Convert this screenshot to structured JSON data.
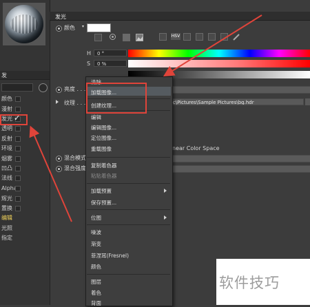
{
  "left_panel": {
    "header": "发",
    "channels": [
      {
        "label": "颜色",
        "checked": false
      },
      {
        "label": "漫射",
        "checked": false
      },
      {
        "label": "发光",
        "checked": true
      },
      {
        "label": "透明",
        "checked": false
      },
      {
        "label": "反射",
        "checked": false
      },
      {
        "label": "环境",
        "checked": false
      },
      {
        "label": "烟雾",
        "checked": false
      },
      {
        "label": "凹凸",
        "checked": false
      },
      {
        "label": "法线",
        "checked": false
      },
      {
        "label": "Alpha",
        "checked": false
      },
      {
        "label": "辉光",
        "checked": false
      },
      {
        "label": "置换",
        "checked": false
      },
      {
        "label": "编辑",
        "checked": false
      },
      {
        "label": "光照",
        "checked": false
      },
      {
        "label": "指定",
        "checked": false
      }
    ],
    "checkmark": "✓"
  },
  "panel": {
    "title": "发光",
    "color_label": "颜色",
    "color_value": "#ffffff",
    "hsv_badge": "HSV",
    "h_label": "H",
    "h_value": "0 °",
    "s_label": "S",
    "s_value": "0 %",
    "brightness_label": "亮度 . . . .",
    "texture_label": "纹理 . . . .",
    "texture_path": "lic\\Pictures\\Sample Pictures\\bg.hdr",
    "color_space_text": "near Color Space",
    "mix_mode_label": "混合模式",
    "mix_strength_label": "混合强度"
  },
  "context_menu": {
    "items": [
      {
        "label": "清除",
        "disabled": false
      },
      {
        "label": "加载图像...",
        "disabled": false
      },
      {
        "label": "创建纹理...",
        "disabled": false
      },
      {
        "label": "编辑",
        "disabled": false
      },
      {
        "label": "编辑图像...",
        "disabled": false
      },
      {
        "label": "定位图像...",
        "disabled": false
      },
      {
        "label": "重载图像",
        "disabled": false
      },
      {
        "label": "复制着色器",
        "disabled": false
      },
      {
        "label": "粘贴着色器",
        "disabled": true
      },
      {
        "label": "加载预置",
        "disabled": false,
        "submenu": true
      },
      {
        "label": "保存预置...",
        "disabled": false
      },
      {
        "label": "位图",
        "disabled": false,
        "submenu": true
      },
      {
        "label": "噪波",
        "disabled": false
      },
      {
        "label": "渐变",
        "disabled": false
      },
      {
        "label": "菲涅耳(Fresnel)",
        "disabled": false
      },
      {
        "label": "颜色",
        "disabled": false
      },
      {
        "label": "图层",
        "disabled": false
      },
      {
        "label": "着色",
        "disabled": false
      },
      {
        "label": "背面",
        "disabled": false
      }
    ]
  },
  "watermark": "软件技巧",
  "colors": {
    "annotation_red": "#e0443a",
    "highlight_yellow": "#f0d25a"
  },
  "icons": [
    "target-icon",
    "texture-swatch-icon",
    "image-icon",
    "eyedropper-icon"
  ]
}
